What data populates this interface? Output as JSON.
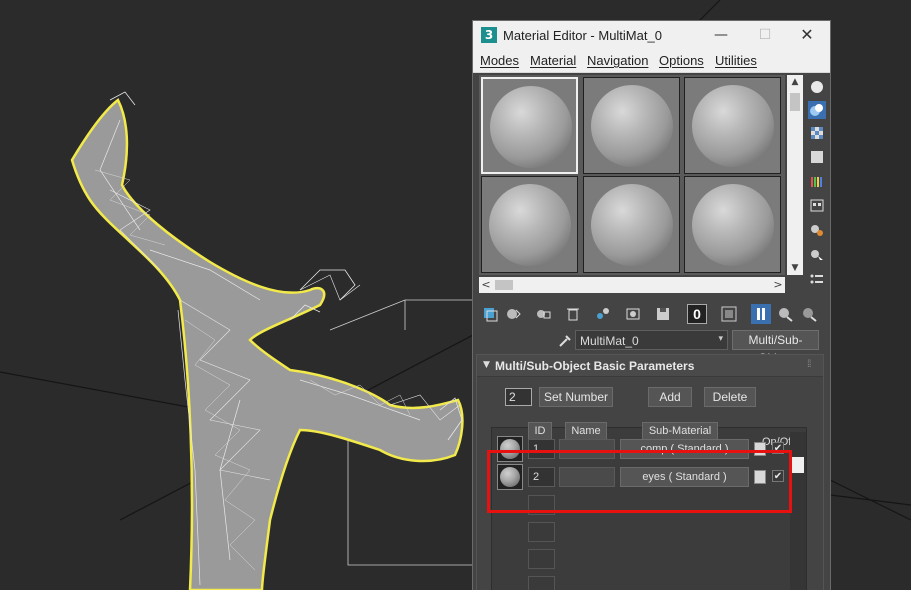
{
  "window": {
    "app_icon": "3",
    "title": "Material Editor - MultiMat_0",
    "minimize_glyph": "—",
    "maximize_glyph": "☐",
    "close_glyph": "✕"
  },
  "menubar": {
    "items": [
      "Modes",
      "Material",
      "Navigation",
      "Options",
      "Utilities"
    ]
  },
  "scroll": {
    "up": "▲",
    "down": "▼",
    "left": "<",
    "right": ">"
  },
  "sample_slots": {
    "count": 6,
    "selected": 1
  },
  "side_toolbar": {
    "icons": [
      "sample-type-sphere-icon",
      "backlight-icon",
      "background-checker-icon",
      "sample-uv-tiling-icon",
      "video-color-check-icon",
      "make-preview-icon",
      "options-icon",
      "select-by-material-icon",
      "material-id-list-icon"
    ]
  },
  "bottom_toolbar": {
    "icons": [
      "get-material-icon",
      "put-to-scene-icon",
      "assign-to-selection-icon",
      "delete-icon",
      "make-unique-icon",
      "put-to-library-icon",
      "save-icon",
      "material-id-channel-icon",
      "show-shaded-icon",
      "show-end-result-icon",
      "go-to-parent-icon",
      "go-forward-icon"
    ],
    "material_id_channel": "0"
  },
  "material": {
    "name": "MultiMat_0",
    "dropdown_glyph": "▾",
    "type": "Multi/Sub-Object"
  },
  "rollout": {
    "arrow": "▼",
    "title": "Multi/Sub-Object Basic Parameters",
    "grip": "⁞⁞",
    "number_of_materials": "2",
    "set_number_label": "Set Number",
    "add_label": "Add",
    "delete_label": "Delete",
    "headers": {
      "id": "ID",
      "name": "Name",
      "sub_material": "Sub-Material",
      "on_off": "On/Off"
    },
    "rows": [
      {
        "id": "1",
        "name": "",
        "sub_material": "comp  ( Standard )",
        "enabled": "✔"
      },
      {
        "id": "2",
        "name": "",
        "sub_material": "eyes  ( Standard )",
        "enabled": "✔"
      }
    ]
  },
  "colors": {
    "viewport_bg": "#2b2b2b",
    "wire": "#e8e8e8",
    "selection_outline": "#f2ea4a",
    "highlight_box": "#e8110f",
    "panel_bg": "#444444"
  }
}
